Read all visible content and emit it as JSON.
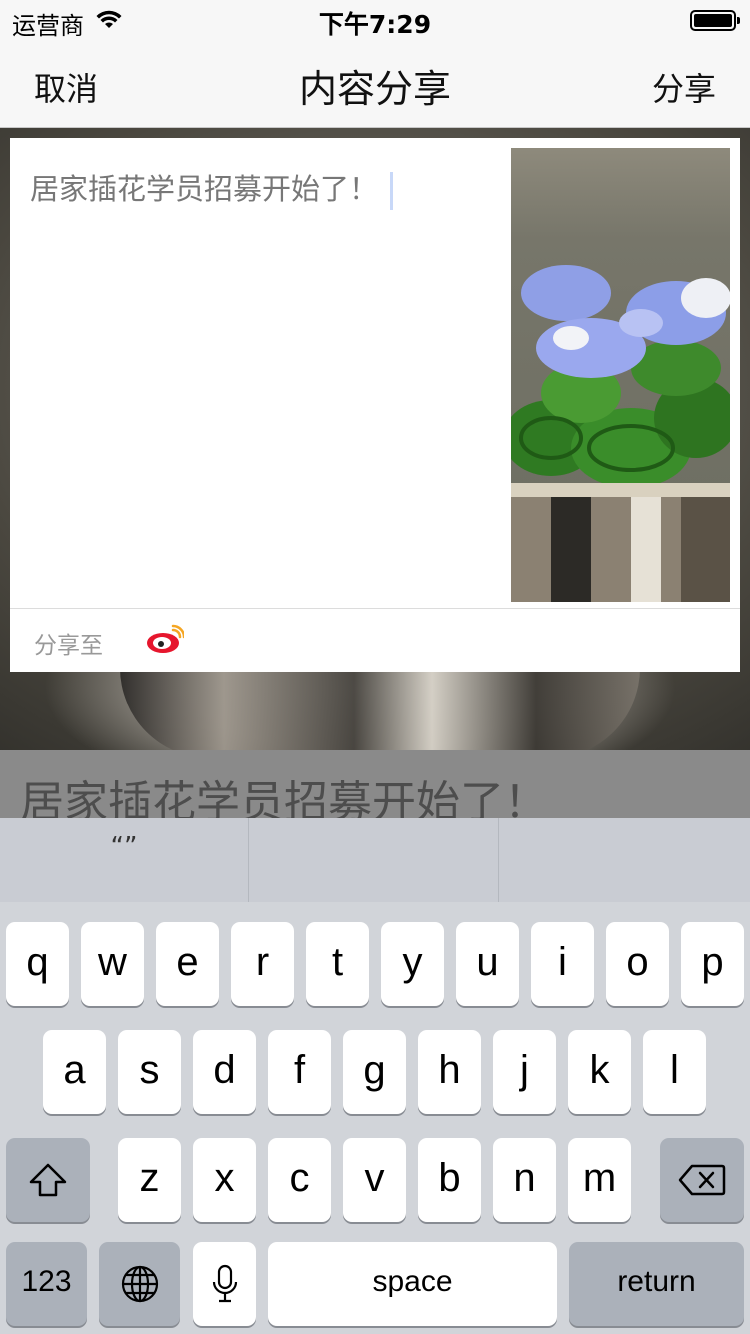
{
  "status_bar": {
    "carrier": "运营商",
    "time": "下午7:29"
  },
  "nav": {
    "cancel": "取消",
    "title": "内容分享",
    "share": "分享"
  },
  "composer": {
    "text": "居家插花学员招募开始了！",
    "share_to_label": "分享至",
    "share_target_icon": "weibo-icon",
    "thumbnail_icon": "flower-photo"
  },
  "caption": "居家插花学员招募开始了！",
  "keyboard": {
    "suggestions": [
      "“”",
      "",
      ""
    ],
    "row1": [
      "q",
      "w",
      "e",
      "r",
      "t",
      "y",
      "u",
      "i",
      "o",
      "p"
    ],
    "row2": [
      "a",
      "s",
      "d",
      "f",
      "g",
      "h",
      "j",
      "k",
      "l"
    ],
    "row3": [
      "z",
      "x",
      "c",
      "v",
      "b",
      "n",
      "m"
    ],
    "numbers_label": "123",
    "space_label": "space",
    "return_label": "return"
  },
  "colors": {
    "weibo": "#e6162d",
    "keyboard_bg": "#d1d4d9",
    "dark_key": "#abb1ba"
  }
}
